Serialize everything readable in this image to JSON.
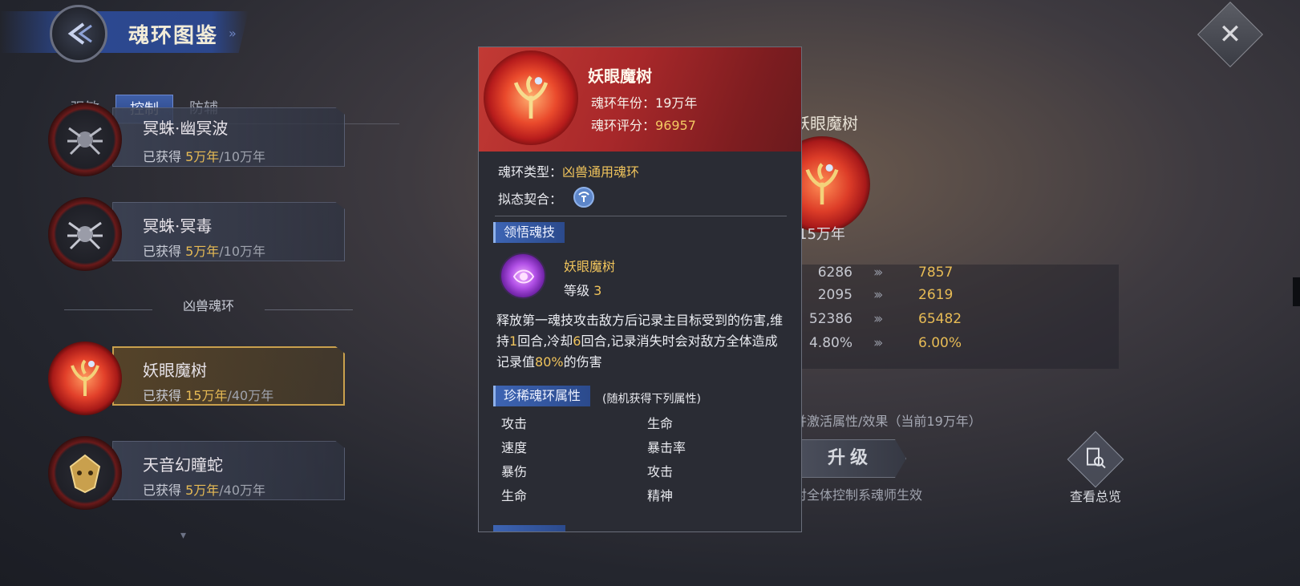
{
  "header": {
    "title": "魂环图鉴",
    "close_icon": "close-x-icon"
  },
  "tabs": [
    {
      "label": "强敏",
      "active": false
    },
    {
      "label": "控制",
      "active": true
    },
    {
      "label": "防辅",
      "active": false
    }
  ],
  "list": {
    "items": [
      {
        "name": "冥蛛·幽冥波",
        "got_prefix": "已获得 ",
        "got_value": "5万年",
        "got_total": "/10万年"
      },
      {
        "name": "冥蛛·冥毒",
        "got_prefix": "已获得 ",
        "got_value": "5万年",
        "got_total": "/10万年"
      },
      {
        "name": "妖眼魔树",
        "got_prefix": "已获得 ",
        "got_value": "15万年",
        "got_total": "/40万年",
        "selected": true
      },
      {
        "name": "天音幻瞳蛇",
        "got_prefix": "已获得 ",
        "got_value": "5万年",
        "got_total": "/40万年"
      }
    ],
    "section_label": "凶兽魂环"
  },
  "detail": {
    "name": "妖眼魔树",
    "year": "15万年",
    "stats": [
      {
        "old": "6286",
        "new": "7857"
      },
      {
        "old": "2095",
        "new": "2619"
      },
      {
        "old": "52386",
        "new": "65482"
      },
      {
        "old": "4.80%",
        "new": "6.00%"
      }
    ],
    "activate_text": "并激活属性/效果（当前19万年）",
    "upgrade_label": "升级",
    "upgrade_note": "对全体控制系魂师生效",
    "overview_label": "查看总览"
  },
  "popup": {
    "title": "妖眼魔树",
    "year_label": "魂环年份：",
    "year_value": "19万年",
    "score_label": "魂环评分：",
    "score_value": "96957",
    "type_label": "魂环类型：",
    "type_value": "凶兽通用魂环",
    "mimic_label": "拟态契合：",
    "skill_badge": "领悟魂技",
    "skill_name": "妖眼魔树",
    "skill_level_label": "等级 ",
    "skill_level_value": "3",
    "desc": {
      "p1": "释放第一魂技攻击敌方后记录主目标受到的伤害,维持",
      "n1": "1",
      "p2": "回合,冷却",
      "n2": "6",
      "p3": "回合,记录消失时会对敌方全体造成记录值",
      "n3": "80%",
      "p4": "的伤害"
    },
    "rare_badge": "珍稀魂环属性",
    "rare_note": "(随机获得下列属性)",
    "attrs": [
      "攻击",
      "生命",
      "速度",
      "暴击率",
      "暴伤",
      "攻击",
      "生命",
      "精神"
    ]
  },
  "colors": {
    "accent_gold": "#f0c45c",
    "tab_blue": "#3f5fa8",
    "popup_red": "#c23a34"
  }
}
